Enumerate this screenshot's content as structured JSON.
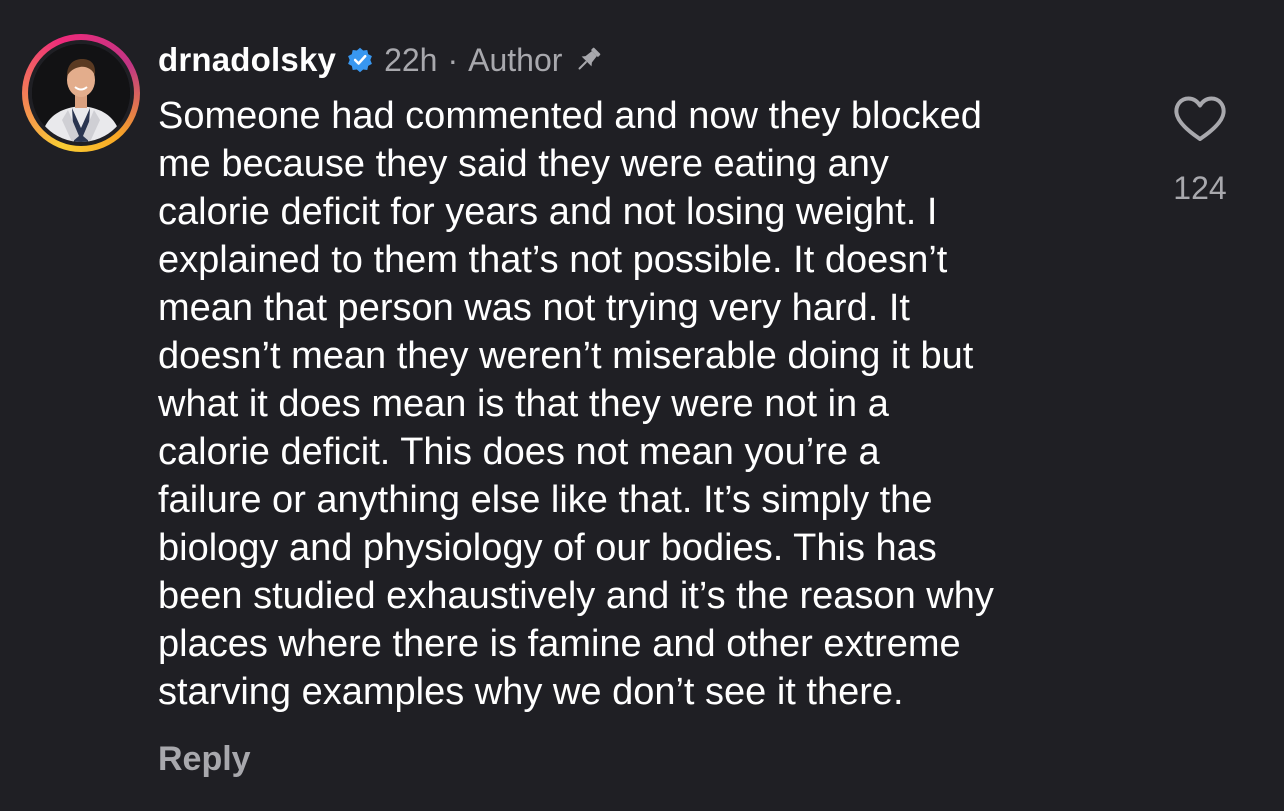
{
  "comment": {
    "username": "drnadolsky",
    "time": "22h",
    "separator": "·",
    "role": "Author",
    "icons": {
      "verified": "verified-badge-icon",
      "pin": "pin-icon",
      "like": "heart-icon"
    },
    "colors": {
      "verified_blue": "#3897f0",
      "muted_text": "#a8a8ad",
      "background": "#1f1f24"
    },
    "text_lines": [
      "Someone had commented and now they blocked",
      "me because they said they were eating any",
      "calorie deficit for years and not losing weight. I",
      "explained to them that’s not possible. It doesn’t",
      "mean that person was not trying very hard. It",
      "doesn’t mean they weren’t miserable doing it but",
      "what it does mean is that they were not in a",
      "calorie deficit. This does not mean you’re a",
      "failure or anything else like that. It’s simply the",
      "biology and physiology of our bodies. This has",
      "been studied exhaustively and it’s the reason why",
      "places where there is famine and other extreme",
      "starving examples why we don’t see it there."
    ],
    "reply_label": "Reply",
    "like_count": "124"
  }
}
